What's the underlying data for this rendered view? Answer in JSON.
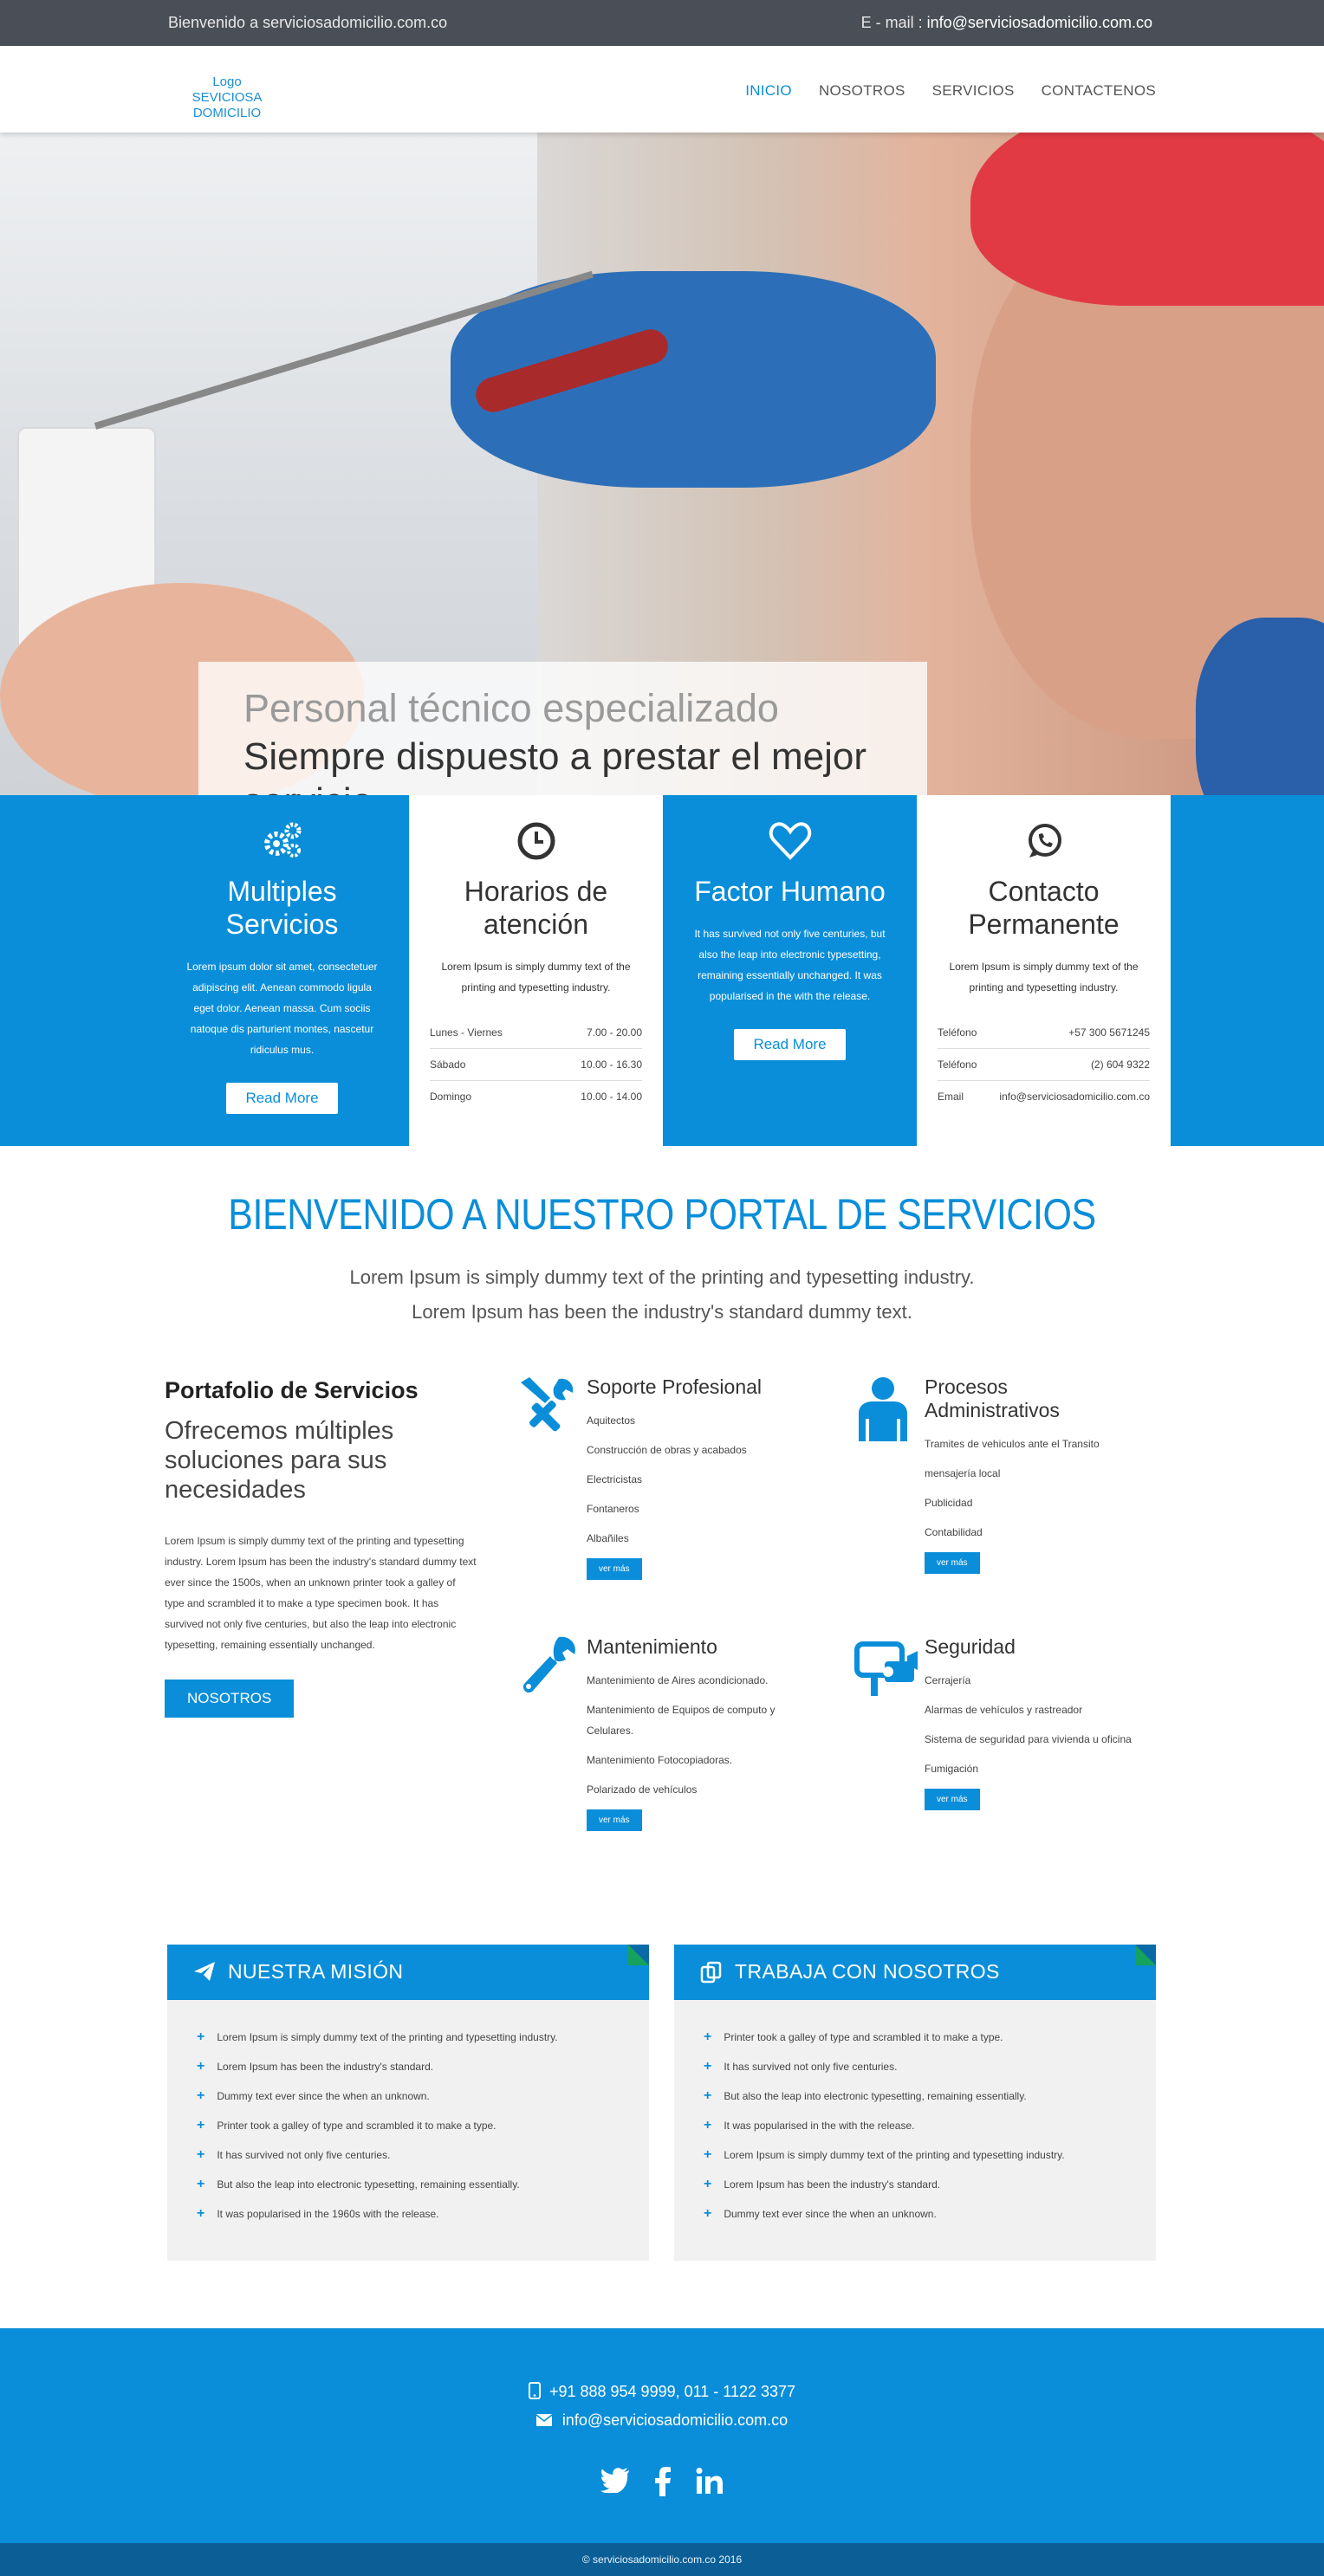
{
  "topbar": {
    "welcome": "Bienvenido a serviciosadomicilio.com.co",
    "email_label": "E - mail : ",
    "email": "info@serviciosadomicilio.com.co"
  },
  "nav": {
    "logo": "Logo SEVICIOSA DOMICILIO",
    "items": [
      "INICIO",
      "NOSOTROS",
      "SERVICIOS",
      "CONTACTENOS"
    ]
  },
  "hero": {
    "subtitle": "Personal técnico especializado",
    "title": "Siempre dispuesto a prestar el mejor servicio"
  },
  "features": [
    {
      "title": "Multiples Servicios",
      "text": "Lorem ipsum dolor sit amet, consectetuer adipiscing elit. Aenean commodo ligula eget dolor. Aenean massa. Cum sociis natoque dis parturient montes, nascetur ridiculus mus.",
      "button": "Read More",
      "icon": "gears-icon"
    },
    {
      "title": "Horarios de atención",
      "text": "Lorem Ipsum is simply dummy text of the printing and typesetting industry.",
      "icon": "clock-icon",
      "rows": [
        {
          "label": "Lunes - Viernes",
          "value": "7.00 - 20.00"
        },
        {
          "label": "Sábado",
          "value": "10.00 - 16.30"
        },
        {
          "label": "Domingo",
          "value": "10.00 - 14.00"
        }
      ]
    },
    {
      "title": "Factor Humano",
      "text": "It has survived not only five centuries, but also the leap into electronic typesetting, remaining essentially unchanged. It was popularised in the with the release.",
      "button": "Read More",
      "icon": "heart-icon"
    },
    {
      "title": "Contacto Permanente",
      "text": "Lorem Ipsum is simply dummy text of the printing and typesetting industry.",
      "icon": "whatsapp-icon",
      "rows": [
        {
          "label": "Teléfono",
          "value": "+57 300 5671245"
        },
        {
          "label": "Teléfono",
          "value": "(2) 604 9322"
        },
        {
          "label": "Email",
          "value": "info@serviciosadomicilio.com.co"
        }
      ]
    }
  ],
  "welcome": {
    "heading": "BIENVENIDO A NUESTRO PORTAL DE SERVICIOS",
    "line1": "Lorem Ipsum is simply dummy text of the printing and typesetting industry.",
    "line2": "Lorem Ipsum has been the industry's standard dummy text."
  },
  "portfolio": {
    "title": "Portafolio de Servicios",
    "subtitle": "Ofrecemos múltiples soluciones para sus necesidades",
    "text": "Lorem Ipsum is simply dummy text of the printing and typesetting industry. Lorem Ipsum has been the industry's standard dummy text ever since the 1500s, when an unknown printer took a galley of type and scrambled it to make a type specimen book. It has survived not only five centuries, but also the leap into electronic typesetting, remaining essentially unchanged.",
    "button": "NOSOTROS"
  },
  "services": [
    {
      "title": "Soporte Profesional",
      "icon": "tools-icon",
      "items": [
        "Aquitectos",
        "Construcción de obras y acabados",
        "Electricistas",
        "Fontaneros",
        "Albañiles"
      ],
      "button": "ver más"
    },
    {
      "title": "Procesos Administrativos",
      "icon": "person-icon",
      "items": [
        "Tramites de vehiculos ante el Transito",
        "mensajería local",
        "Publicidad",
        "Contabilidad"
      ],
      "button": "ver más"
    },
    {
      "title": "Mantenimiento",
      "icon": "wrench-icon",
      "items": [
        "Mantenimiento de Aires acondicionado.",
        "Mantenimiento de Equipos de computo y Celulares.",
        "Mantenimiento Fotocopiadoras.",
        "Polarizado de vehículos"
      ],
      "button": "ver más"
    },
    {
      "title": "Seguridad",
      "icon": "camera-icon",
      "items": [
        "Cerrajería",
        "Alarmas de vehículos y rastreador",
        "Sistema de seguridad para vivienda u oficina",
        "Fumigación"
      ],
      "button": "ver más"
    }
  ],
  "panels": [
    {
      "title": "NUESTRA MISIÓN",
      "icon": "paper-plane-icon",
      "items": [
        "Lorem Ipsum is simply dummy text of the printing and typesetting industry.",
        "Lorem Ipsum has been the industry's standard.",
        "Dummy text ever since the when an unknown.",
        "Printer took a galley of type and scrambled it to make a type.",
        "It has survived not only five centuries.",
        "But also the leap into electronic typesetting, remaining essentially.",
        "It was popularised in the 1960s with the release."
      ]
    },
    {
      "title": "TRABAJA CON NOSOTROS",
      "icon": "copy-icon",
      "items": [
        "Printer took a galley of type and scrambled it to make a type.",
        "It has survived not only five centuries.",
        "But also the leap into electronic typesetting, remaining essentially.",
        "It was popularised in the with the release.",
        "Lorem Ipsum is simply dummy text of the printing and typesetting industry.",
        "Lorem Ipsum has been the industry's standard.",
        "Dummy text ever since the when an unknown."
      ]
    }
  ],
  "footer": {
    "phone": "+91 888 954 9999, 011 - 1122 3377",
    "email": "info@serviciosadomicilio.com.co",
    "social": [
      "twitter-icon",
      "facebook-icon",
      "linkedin-icon"
    ],
    "copyright": "© serviciosadomicilio.com.co 2016"
  },
  "colors": {
    "accent": "#0a8ed9",
    "topbar": "#4a4f57",
    "copyright_bg": "#0c5f96"
  }
}
